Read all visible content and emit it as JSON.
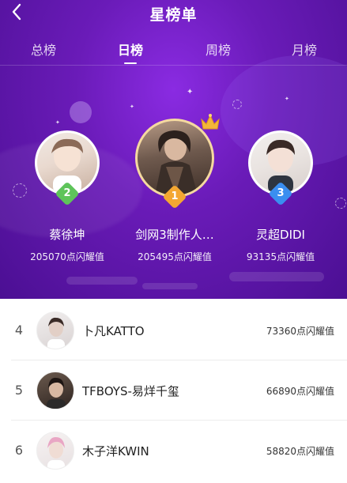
{
  "header": {
    "back_icon": "chevron-left-icon",
    "title": "星榜单"
  },
  "tabs": [
    {
      "label": "总榜",
      "active": false
    },
    {
      "label": "日榜",
      "active": true
    },
    {
      "label": "周榜",
      "active": false
    },
    {
      "label": "月榜",
      "active": false
    }
  ],
  "top3": [
    {
      "rank": "2",
      "name": "蔡徐坤",
      "score": "205070点闪耀值",
      "badge_color": "#5ec45a"
    },
    {
      "rank": "1",
      "name": "剑网3制作人…",
      "score": "205495点闪耀值",
      "badge_color": "#f4a732"
    },
    {
      "rank": "3",
      "name": "灵超DIDI",
      "score": "93135点闪耀值",
      "badge_color": "#3a8ef0"
    }
  ],
  "list": [
    {
      "rank": "4",
      "name": "卜凡KATTO",
      "score": "73360点闪耀值"
    },
    {
      "rank": "5",
      "name": "TFBOYS-易烊千玺",
      "score": "66890点闪耀值"
    },
    {
      "rank": "6",
      "name": "木子洋KWIN",
      "score": "58820点闪耀值"
    }
  ],
  "colors": {
    "hero_bg": "#6a1bb8",
    "crown": "#f4b63a"
  }
}
